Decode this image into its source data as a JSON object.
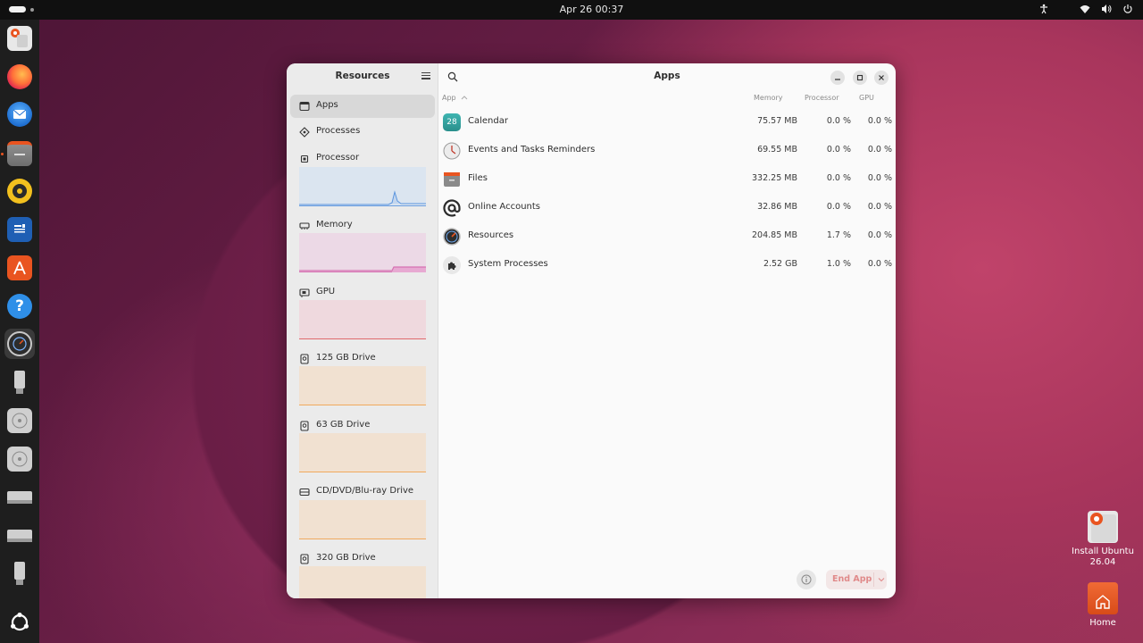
{
  "topbar": {
    "clock": "Apr 26  00:37",
    "icons": [
      "accessibility-icon",
      "wifi-icon",
      "volume-icon",
      "power-icon"
    ]
  },
  "dock": {
    "items": [
      "install-ubuntu",
      "firefox",
      "thunderbird",
      "files",
      "rhythmbox",
      "writer",
      "app-center",
      "help",
      "resources",
      "usb-drive",
      "disc-drive",
      "disc-drive-2",
      "drive",
      "drive-2",
      "usb-drive-2",
      "show-apps"
    ],
    "accent": "#e95420"
  },
  "desktop": {
    "install_label": "Install Ubuntu 26.04",
    "home_label": "Home"
  },
  "sidebar": {
    "title": "Resources",
    "items": [
      {
        "label": "Apps"
      },
      {
        "label": "Processes"
      },
      {
        "label": "Processor"
      },
      {
        "label": "Memory"
      },
      {
        "label": "GPU"
      },
      {
        "label": "125 GB Drive"
      },
      {
        "label": "63 GB Drive"
      },
      {
        "label": "CD/DVD/Blu-ray Drive"
      },
      {
        "label": "320 GB Drive"
      }
    ]
  },
  "content": {
    "title": "Apps",
    "columns": {
      "app": "App",
      "memory": "Memory",
      "processor": "Processor",
      "gpu": "GPU"
    },
    "rows": [
      {
        "name": "Calendar",
        "memory": "75.57 MB",
        "cpu": "0.0 %",
        "gpu": "0.0 %",
        "icon": "calendar-icon",
        "icon_text": "28"
      },
      {
        "name": "Events and Tasks Reminders",
        "memory": "69.55 MB",
        "cpu": "0.0 %",
        "gpu": "0.0 %",
        "icon": "clock-icon"
      },
      {
        "name": "Files",
        "memory": "332.25 MB",
        "cpu": "0.0 %",
        "gpu": "0.0 %",
        "icon": "folder-icon"
      },
      {
        "name": "Online Accounts",
        "memory": "32.86 MB",
        "cpu": "0.0 %",
        "gpu": "0.0 %",
        "icon": "at-sign-icon"
      },
      {
        "name": "Resources",
        "memory": "204.85 MB",
        "cpu": "1.7 %",
        "gpu": "0.0 %",
        "icon": "gauge-icon"
      },
      {
        "name": "System Processes",
        "memory": "2.52 GB",
        "cpu": "1.0 %",
        "gpu": "0.0 %",
        "icon": "puzzle-icon"
      }
    ],
    "end_app_label": "End App"
  }
}
